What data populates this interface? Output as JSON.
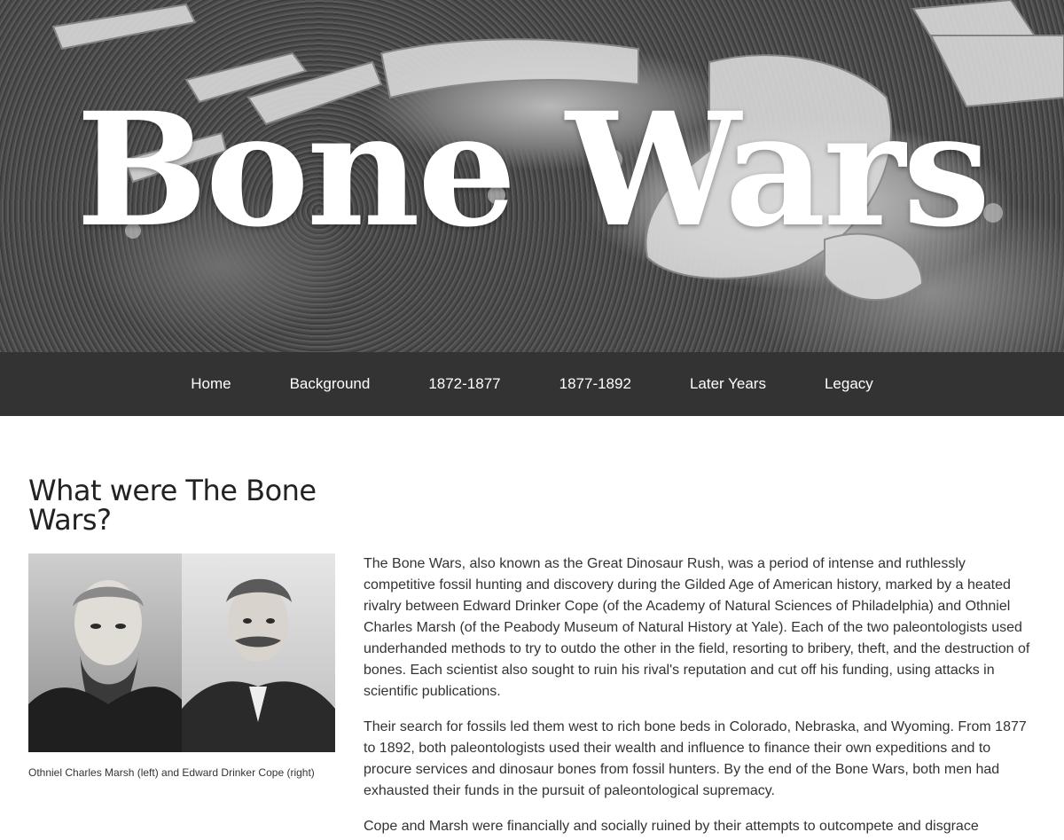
{
  "hero": {
    "title": "Bone Wars"
  },
  "nav": {
    "items": [
      {
        "label": "Home"
      },
      {
        "label": "Background"
      },
      {
        "label": "1872-1877"
      },
      {
        "label": "1877-1892"
      },
      {
        "label": "Later Years"
      },
      {
        "label": "Legacy"
      }
    ]
  },
  "main": {
    "title": "What were The Bone Wars?",
    "figure": {
      "caption": "Othniel Charles Marsh (left) and Edward Drinker Cope (right)"
    },
    "paragraphs": [
      "The Bone Wars, also known as the Great Dinosaur Rush, was a period of intense and ruthlessly competitive fossil hunting and discovery during the Gilded Age of American history, marked by a heated rivalry between Edward Drinker Cope (of the Academy of Natural Sciences of Philadelphia) and Othniel Charles Marsh (of the Peabody Museum of Natural History at Yale). Each of the two paleontologists used underhanded methods to try to outdo the other in the field, resorting to bribery, theft, and the destruction of bones. Each scientist also sought to ruin his rival's reputation and cut off his funding, using attacks in scientific publications.",
      "Their search for fossils led them west to rich bone beds in Colorado, Nebraska, and Wyoming. From 1877 to 1892, both paleontologists used their wealth and influence to finance their own expeditions and to procure services and dinosaur bones from fossil hunters. By the end of the Bone Wars, both men had exhausted their funds in the pursuit of paleontological supremacy.",
      "Cope and Marsh were financially and socially ruined by their attempts to outcompete and disgrace"
    ]
  },
  "colors": {
    "nav_background": "#333333",
    "nav_text": "#ffffff",
    "body_text": "#333333",
    "heading_text": "#222222"
  }
}
